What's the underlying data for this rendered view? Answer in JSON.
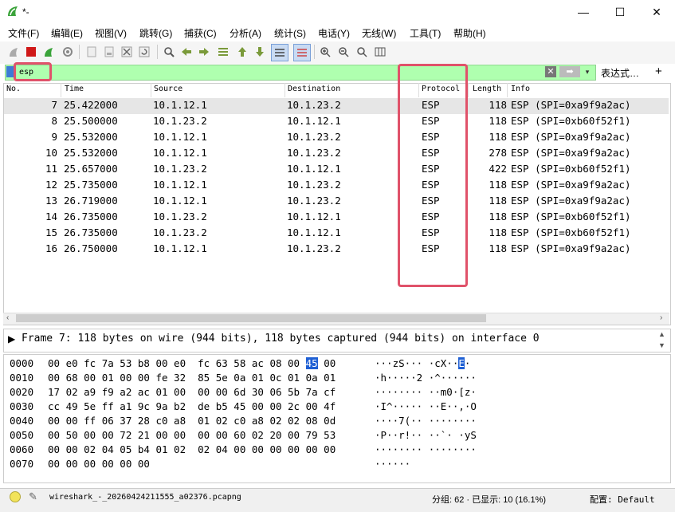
{
  "window": {
    "title": "*-",
    "minimize": "—",
    "maximize": "☐",
    "close": "✕"
  },
  "menu": [
    "文件(F)",
    "编辑(E)",
    "视图(V)",
    "跳转(G)",
    "捕获(C)",
    "分析(A)",
    "统计(S)",
    "电话(Y)",
    "无线(W)",
    "工具(T)",
    "帮助(H)"
  ],
  "filter": {
    "value": "esp",
    "expression_label": "表达式…",
    "add": "+",
    "clear": "✕",
    "apply": "➡",
    "dropdown": "▾"
  },
  "columns": [
    "No.",
    "Time",
    "Source",
    "Destination",
    "Protocol",
    "Length",
    "Info"
  ],
  "packets": [
    {
      "no": "7",
      "time": "25.422000",
      "src": "10.1.12.1",
      "dst": "10.1.23.2",
      "proto": "ESP",
      "len": "118",
      "info": "ESP (SPI=0xa9f9a2ac)"
    },
    {
      "no": "8",
      "time": "25.500000",
      "src": "10.1.23.2",
      "dst": "10.1.12.1",
      "proto": "ESP",
      "len": "118",
      "info": "ESP (SPI=0xb60f52f1)"
    },
    {
      "no": "9",
      "time": "25.532000",
      "src": "10.1.12.1",
      "dst": "10.1.23.2",
      "proto": "ESP",
      "len": "118",
      "info": "ESP (SPI=0xa9f9a2ac)"
    },
    {
      "no": "10",
      "time": "25.532000",
      "src": "10.1.12.1",
      "dst": "10.1.23.2",
      "proto": "ESP",
      "len": "278",
      "info": "ESP (SPI=0xa9f9a2ac)"
    },
    {
      "no": "11",
      "time": "25.657000",
      "src": "10.1.23.2",
      "dst": "10.1.12.1",
      "proto": "ESP",
      "len": "422",
      "info": "ESP (SPI=0xb60f52f1)"
    },
    {
      "no": "12",
      "time": "25.735000",
      "src": "10.1.12.1",
      "dst": "10.1.23.2",
      "proto": "ESP",
      "len": "118",
      "info": "ESP (SPI=0xa9f9a2ac)"
    },
    {
      "no": "13",
      "time": "26.719000",
      "src": "10.1.12.1",
      "dst": "10.1.23.2",
      "proto": "ESP",
      "len": "118",
      "info": "ESP (SPI=0xa9f9a2ac)"
    },
    {
      "no": "14",
      "time": "26.735000",
      "src": "10.1.23.2",
      "dst": "10.1.12.1",
      "proto": "ESP",
      "len": "118",
      "info": "ESP (SPI=0xb60f52f1)"
    },
    {
      "no": "15",
      "time": "26.735000",
      "src": "10.1.23.2",
      "dst": "10.1.12.1",
      "proto": "ESP",
      "len": "118",
      "info": "ESP (SPI=0xb60f52f1)"
    },
    {
      "no": "16",
      "time": "26.750000",
      "src": "10.1.12.1",
      "dst": "10.1.23.2",
      "proto": "ESP",
      "len": "118",
      "info": "ESP (SPI=0xa9f9a2ac)"
    }
  ],
  "detail": {
    "arrow": "▶",
    "text": "Frame 7: 118 bytes on wire (944 bits), 118 bytes captured (944 bits) on interface 0"
  },
  "bytes": [
    {
      "off": "0000",
      "hex": "00 e0 fc 7a 53 b8 00 e0  fc 63 58 ac 08 00 ",
      "hexsel": "45",
      "hexend": " 00",
      "ascii": "···zS··· ·cX··",
      "asciisel": "E",
      "asciiend": "·"
    },
    {
      "off": "0010",
      "hex": "00 68 00 01 00 00 fe 32  85 5e 0a 01 0c 01 0a 01",
      "ascii": "·h·····2 ·^······"
    },
    {
      "off": "0020",
      "hex": "17 02 a9 f9 a2 ac 01 00  00 00 6d 30 06 5b 7a cf",
      "ascii": "········ ··m0·[z·"
    },
    {
      "off": "0030",
      "hex": "cc 49 5e ff a1 9c 9a b2  de b5 45 00 00 2c 00 4f",
      "ascii": "·I^····· ··E··,·O"
    },
    {
      "off": "0040",
      "hex": "00 00 ff 06 37 28 c0 a8  01 02 c0 a8 02 02 08 0d",
      "ascii": "····7(·· ········"
    },
    {
      "off": "0050",
      "hex": "00 50 00 00 72 21 00 00  00 00 60 02 20 00 79 53",
      "ascii": "·P··r!·· ··`· ·yS"
    },
    {
      "off": "0060",
      "hex": "00 00 02 04 05 b4 01 02  02 04 00 00 00 00 00 00",
      "ascii": "········ ········"
    },
    {
      "off": "0070",
      "hex": "00 00 00 00 00 00",
      "ascii": "······"
    }
  ],
  "status": {
    "file": "wireshark_-_20260424211555_a02376.pcapng",
    "stats": "分组: 62 · 已显示: 10 (16.1%)",
    "profile": "配置: Default"
  },
  "colors": {
    "highlight": "#e0526a",
    "filter_bg": "#afffaf",
    "selected_row": "#e6e6e6"
  }
}
